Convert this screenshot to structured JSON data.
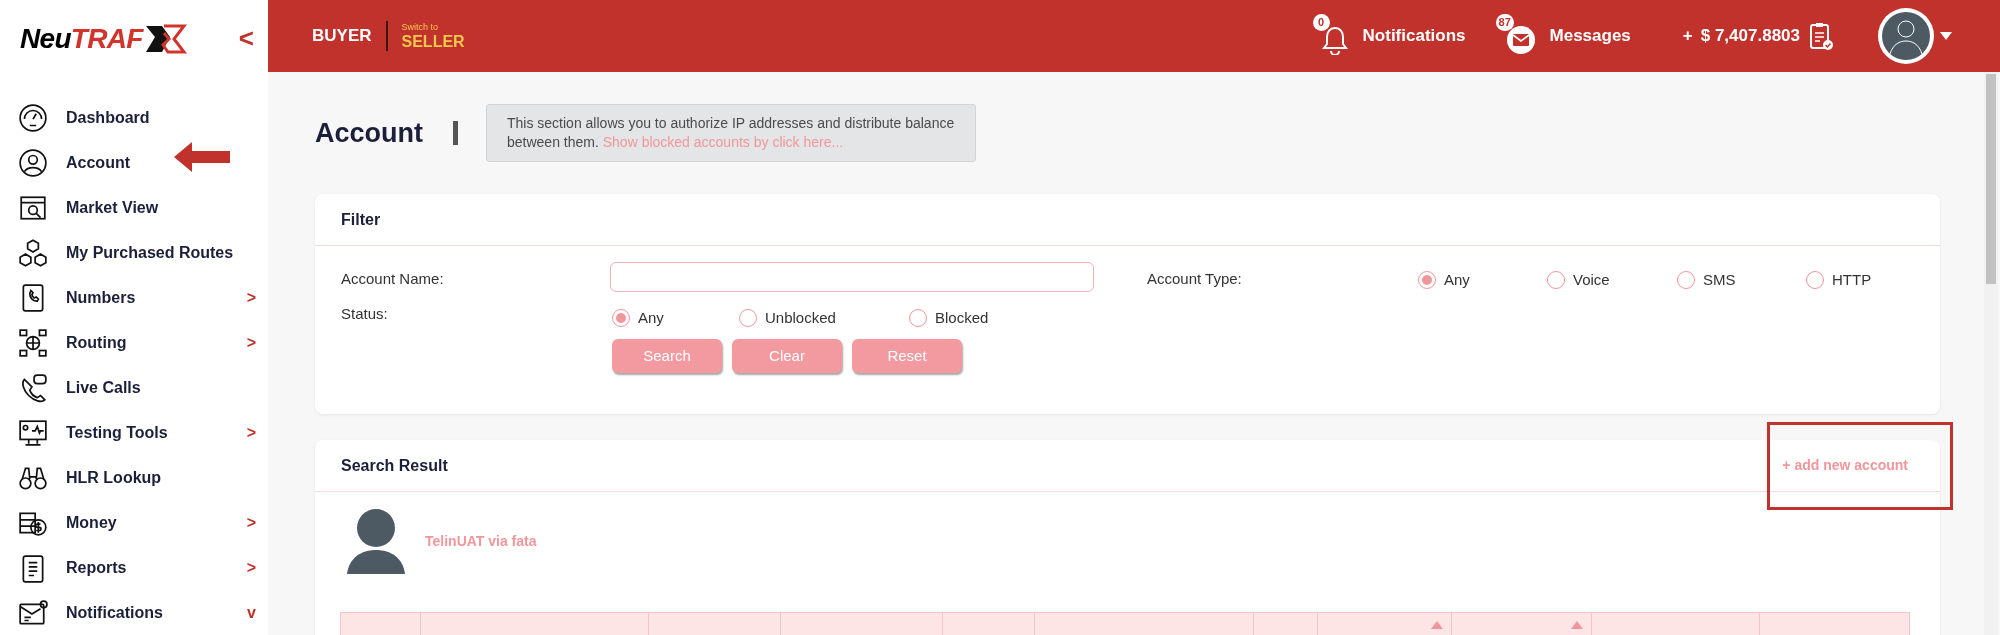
{
  "logo": {
    "part_1": "Neu",
    "part_2": "TRAF"
  },
  "sidebar": {
    "collapse": "<",
    "items": [
      {
        "label": "Dashboard"
      },
      {
        "label": "Account"
      },
      {
        "label": "Market View"
      },
      {
        "label": "My Purchased Routes"
      },
      {
        "label": "Numbers",
        "chevron": ">"
      },
      {
        "label": "Routing",
        "chevron": ">"
      },
      {
        "label": "Live Calls"
      },
      {
        "label": "Testing Tools",
        "chevron": ">"
      },
      {
        "label": "HLR Lookup"
      },
      {
        "label": "Money",
        "chevron": ">"
      },
      {
        "label": "Reports",
        "chevron": ">"
      },
      {
        "label": "Notifications",
        "chevron": "v"
      }
    ]
  },
  "header": {
    "role": "BUYER",
    "switch_hint": "Switch to",
    "switch_target": "SELLER",
    "notifications": {
      "count": "0",
      "label": "Notifications"
    },
    "messages": {
      "count": "87",
      "label": "Messages"
    },
    "balance_plus": "+",
    "balance": "$ 7,407.8803"
  },
  "page": {
    "title": "Account",
    "info": "This section allows you to authorize IP addresses and distribute balance between them.",
    "info_link": "Show blocked accounts by click here..."
  },
  "filter": {
    "title": "Filter",
    "account_name_label": "Account Name:",
    "account_type_label": "Account Type:",
    "account_types": [
      {
        "label": "Any",
        "selected": true
      },
      {
        "label": "Voice",
        "selected": false
      },
      {
        "label": "SMS",
        "selected": false
      },
      {
        "label": "HTTP",
        "selected": false
      }
    ],
    "status_label": "Status:",
    "statuses": [
      {
        "label": "Any",
        "selected": true
      },
      {
        "label": "Unblocked",
        "selected": false
      },
      {
        "label": "Blocked",
        "selected": false
      }
    ],
    "buttons": [
      "Search",
      "Clear",
      "Reset"
    ]
  },
  "results": {
    "title": "Search Result",
    "add_link": "+ add new account",
    "account_name": "TelinUAT via fata"
  }
}
